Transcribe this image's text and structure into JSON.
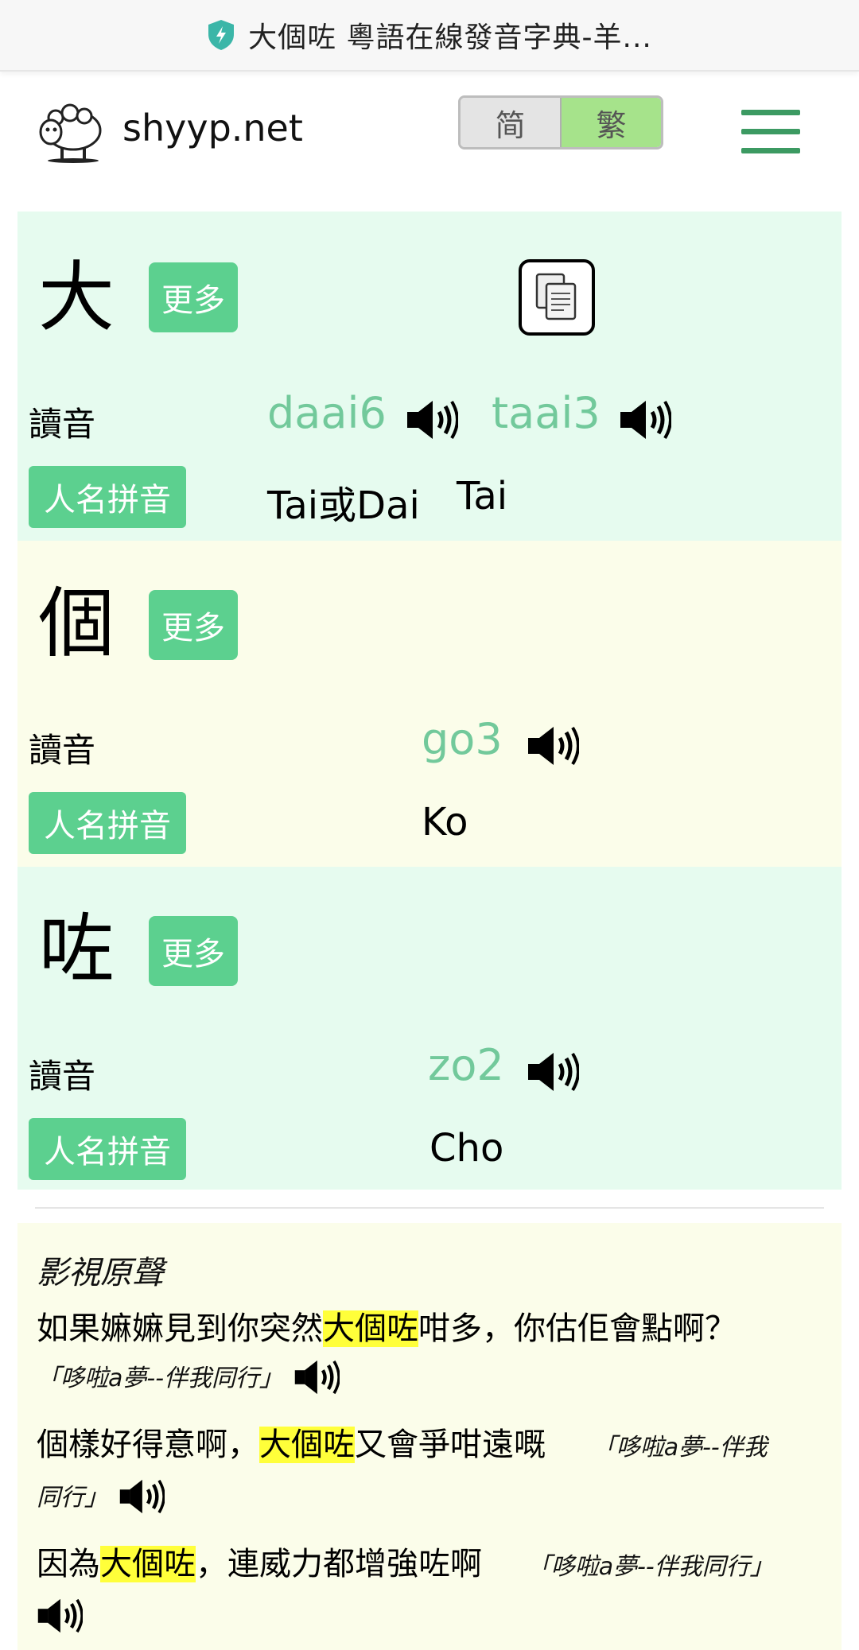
{
  "browser": {
    "page_title": "大個咗 粵語在線發音字典-羊...",
    "icon": "shield-bolt-icon"
  },
  "header": {
    "site_name": "shyyp.net",
    "logo_icon": "sheep-logo-icon",
    "toggle": {
      "simplified": "简",
      "traditional": "繁",
      "active": "traditional"
    },
    "menu_icon": "hamburger-menu-icon"
  },
  "colors": {
    "accent_green": "#5cd08f",
    "jyutping_green": "#72c99b",
    "card_green_bg": "#e6fbef",
    "card_yellow_bg": "#fbfdea",
    "highlight": "#ffff3a",
    "toggle_active": "#a6e38b"
  },
  "characters": [
    {
      "char": "大",
      "more_label": "更多",
      "reading_label": "讀音",
      "readings": [
        "daai6",
        "taai3"
      ],
      "name_pinyin_label": "人名拼音",
      "name_pinyin": [
        "Tai或Dai",
        "Tai"
      ]
    },
    {
      "char": "個",
      "more_label": "更多",
      "reading_label": "讀音",
      "readings": [
        "go3"
      ],
      "name_pinyin_label": "人名拼音",
      "name_pinyin": [
        "Ko"
      ]
    },
    {
      "char": "咗",
      "more_label": "更多",
      "reading_label": "讀音",
      "readings": [
        "zo2"
      ],
      "name_pinyin_label": "人名拼音",
      "name_pinyin": [
        "Cho"
      ]
    }
  ],
  "media": {
    "title": "影視原聲",
    "examples": [
      {
        "before": "如果嫲嫲見到你突然",
        "highlight": "大個咗",
        "after": "咁多，你估佢會點啊？",
        "source": "「哆啦a夢--伴我同行」"
      },
      {
        "before": "個樣好得意啊，",
        "highlight": "大個咗",
        "after": "又會爭咁遠嘅",
        "source_part1": "「哆啦a夢--伴我",
        "source_part2": "同行」"
      },
      {
        "before": "因為",
        "highlight": "大個咗",
        "after": "，連威力都增強咗啊",
        "source": "「哆啦a夢--伴我同行」"
      }
    ]
  }
}
